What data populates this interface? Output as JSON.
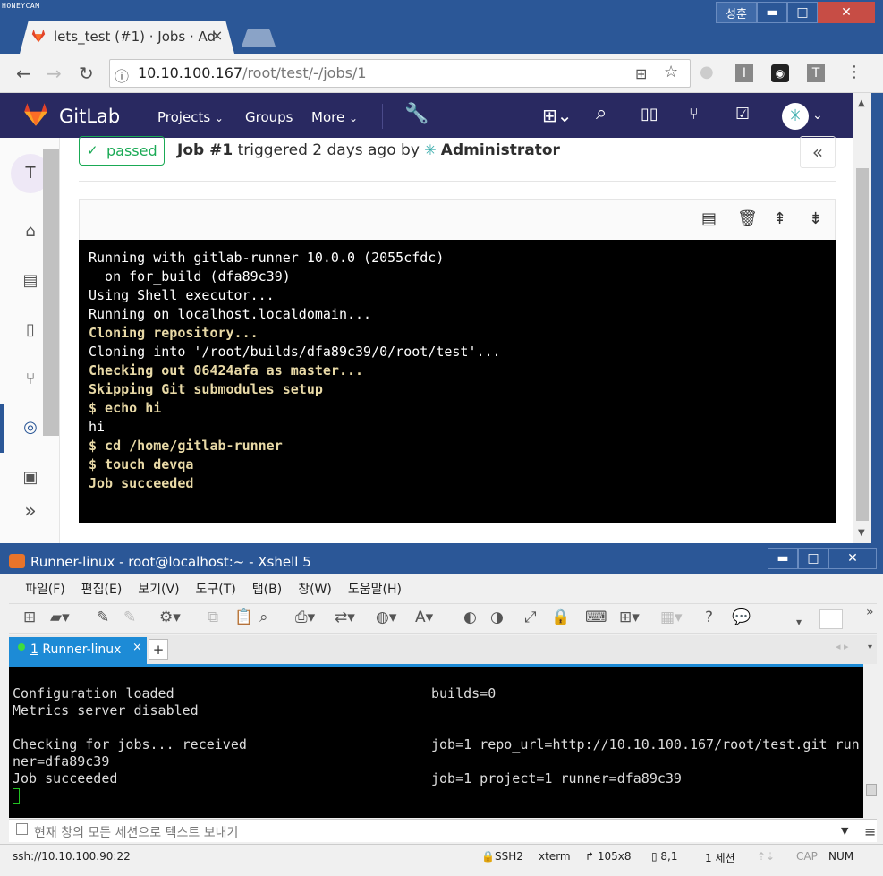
{
  "watermark": "HONEYCAM",
  "browser": {
    "tab_title": "lets_test (#1) · Jobs · Ad",
    "profile_name": "성훈",
    "url_host": "10.10.100.167",
    "url_path": "/root/test/-/jobs/1"
  },
  "gitlab": {
    "brand": "GitLab",
    "nav": {
      "projects": "Projects",
      "groups": "Groups",
      "more": "More"
    },
    "sidebar_avatar": "T",
    "job": {
      "status": "passed",
      "title": "Job #1",
      "triggered_text": " triggered 2 days ago by ",
      "author": "Administrator"
    },
    "log_lines": [
      {
        "text": "Running with gitlab-runner 10.0.0 (2055cfdc)",
        "hl": false
      },
      {
        "text": "  on for_build (dfa89c39)",
        "hl": false
      },
      {
        "text": "Using Shell executor...",
        "hl": false
      },
      {
        "text": "Running on localhost.localdomain...",
        "hl": false
      },
      {
        "text": "Cloning repository...",
        "hl": true
      },
      {
        "text": "Cloning into '/root/builds/dfa89c39/0/root/test'...",
        "hl": false
      },
      {
        "text": "Checking out 06424afa as master...",
        "hl": true
      },
      {
        "text": "Skipping Git submodules setup",
        "hl": true
      },
      {
        "text": "$ echo hi",
        "hl": true
      },
      {
        "text": "hi",
        "hl": false
      },
      {
        "text": "$ cd /home/gitlab-runner",
        "hl": true
      },
      {
        "text": "$ touch devqa",
        "hl": true
      },
      {
        "text": "Job succeeded",
        "hl": true
      }
    ]
  },
  "xshell": {
    "title": "Runner-linux - root@localhost:~ - Xshell 5",
    "menu": [
      "파일(F)",
      "편집(E)",
      "보기(V)",
      "도구(T)",
      "탭(B)",
      "창(W)",
      "도움말(H)"
    ],
    "tab_label_num": "1",
    "tab_label": " Runner-linux",
    "lines": [
      {
        "left": "Configuration loaded",
        "right": "builds=0"
      },
      {
        "left": "Metrics server disabled",
        "right": ""
      },
      {
        "left": "",
        "right": ""
      },
      {
        "left": "Checking for jobs... received",
        "right": "job=1 repo_url=http://10.10.100.167/root/test.git run"
      },
      {
        "left": "ner=dfa89c39",
        "right": ""
      },
      {
        "left": "Job succeeded",
        "right": "job=1 project=1 runner=dfa89c39"
      }
    ],
    "input_placeholder": "현재 창의 모든 세션으로 텍스트 보내기",
    "status": {
      "address": "ssh://10.10.100.90:22",
      "protocol": "SSH2",
      "terminal": "xterm",
      "size": "105x8",
      "cursor_pos": "8,1",
      "sessions": "1 세션",
      "cap": "CAP",
      "num": "NUM"
    }
  }
}
